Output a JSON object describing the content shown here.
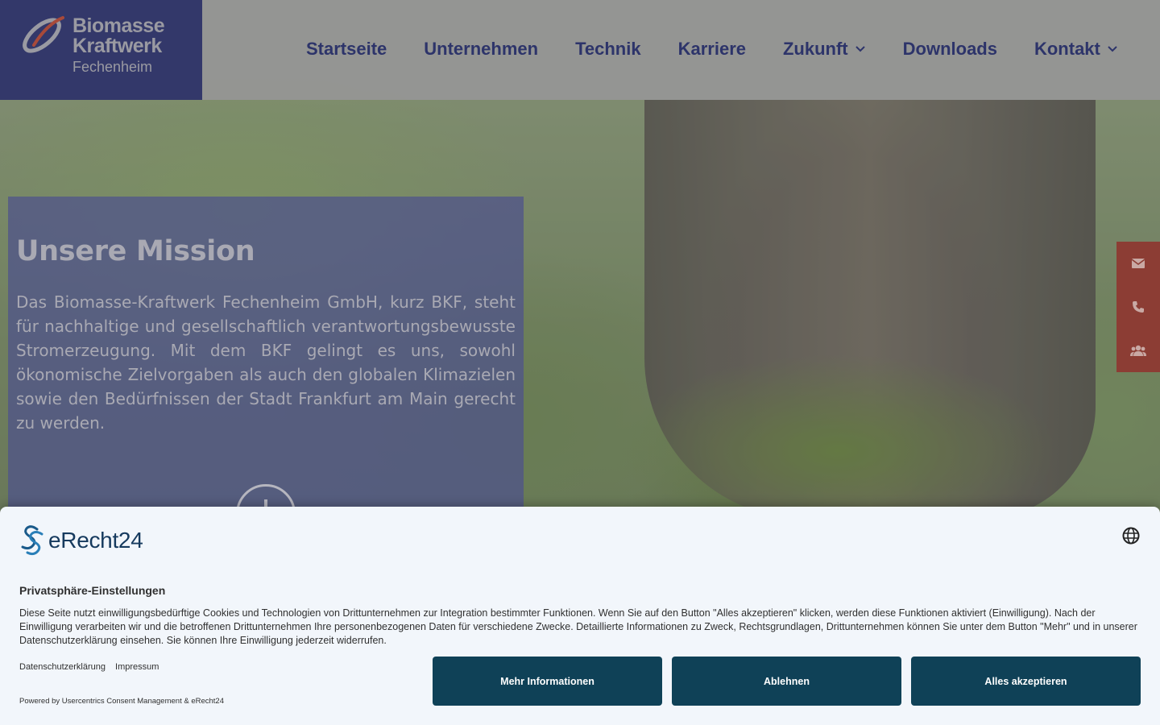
{
  "header": {
    "logo": {
      "line1": "Biomasse",
      "line2": "Kraftwerk",
      "line3": "Fechenheim"
    },
    "nav": [
      {
        "label": "Startseite",
        "has_dropdown": false
      },
      {
        "label": "Unternehmen",
        "has_dropdown": false
      },
      {
        "label": "Technik",
        "has_dropdown": false
      },
      {
        "label": "Karriere",
        "has_dropdown": false
      },
      {
        "label": "Zukunft",
        "has_dropdown": true
      },
      {
        "label": "Downloads",
        "has_dropdown": false
      },
      {
        "label": "Kontakt",
        "has_dropdown": true
      }
    ]
  },
  "mission": {
    "title": "Unsere Mission",
    "body": "Das Biomasse-Kraftwerk Fechenheim GmbH, kurz BKF, steht für nachhaltige und gesellschaftlich verantwortungsbewusste Stromerzeugung. Mit dem BKF gelingt es uns, sowohl ökonomische Zielvorgaben als auch den globalen Klimazielen sowie den Bedürfnissen der Stadt Frankfurt am Main gerecht zu werden."
  },
  "side_contact": {
    "icons": [
      "envelope-icon",
      "phone-icon",
      "users-icon"
    ]
  },
  "consent": {
    "brand": "eRecht24",
    "title": "Privatsphäre-Einstellungen",
    "description": "Diese Seite nutzt einwilligungsbedürftige Cookies und Technologien von Drittunternehmen zur Integration bestimmter Funktionen. Wenn Sie auf den Button \"Alles akzeptieren\" klicken, werden diese Funktionen aktiviert (Einwilligung). Nach der Einwilligung verarbeiten wir und die betroffenen Drittunternehmen Ihre personenbezogenen Daten für verschiedene Zwecke. Detaillierte Informationen zu Zweck, Rechtsgrundlagen, Drittunternehmen können Sie unter dem Button \"Mehr\" und in unserer Datenschutzerklärung einsehen. Sie können Ihre Einwilligung jederzeit widerrufen.",
    "links": {
      "privacy": "Datenschutzerklärung",
      "imprint": "Impressum"
    },
    "powered_by": "Powered by Usercentrics Consent Management & eRecht24",
    "buttons": {
      "more": "Mehr Informationen",
      "deny": "Ablehnen",
      "accept": "Alles akzeptieren"
    }
  },
  "colors": {
    "brand_navy": "#33386a",
    "nav_text": "#2d346a",
    "side_bar": "#8c3d34",
    "consent_button": "#0f4157"
  }
}
